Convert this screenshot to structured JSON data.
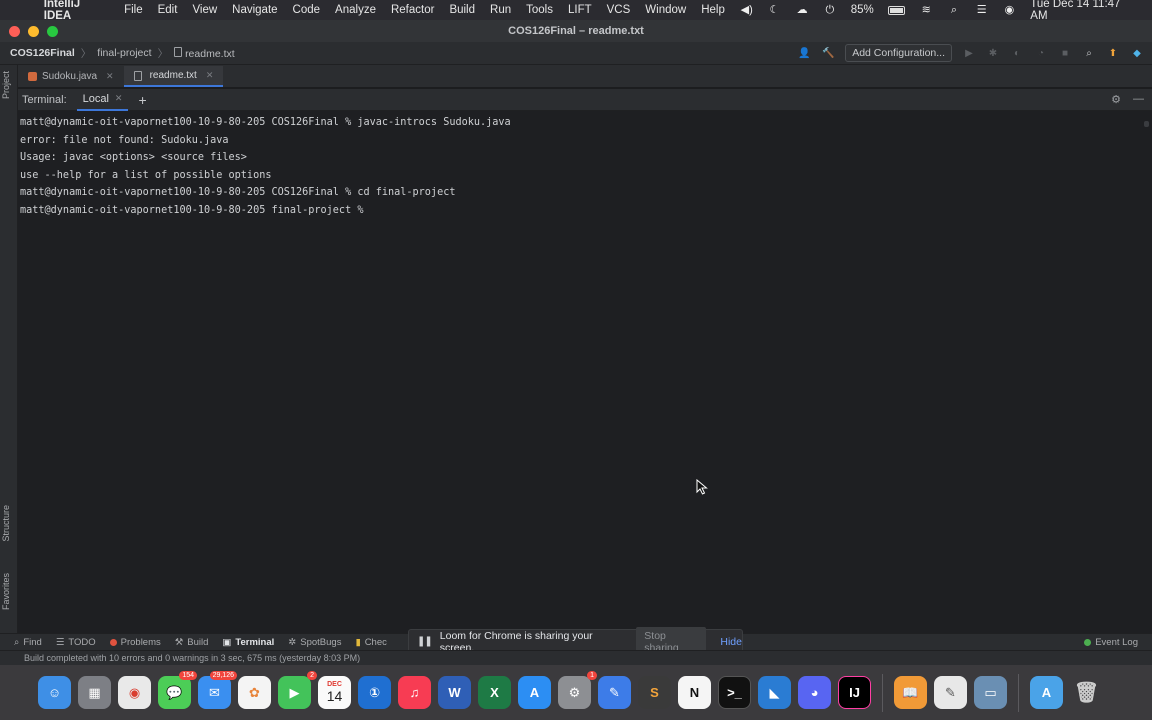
{
  "menubar": {
    "app_name": "IntelliJ IDEA",
    "items": [
      "File",
      "Edit",
      "View",
      "Navigate",
      "Code",
      "Analyze",
      "Refactor",
      "Build",
      "Run",
      "Tools",
      "LIFT",
      "VCS",
      "Window",
      "Help"
    ],
    "battery": "85%",
    "datetime": "Tue Dec 14  11:47 AM"
  },
  "window": {
    "title": "COS126Final – readme.txt"
  },
  "navbar": {
    "project": "COS126Final",
    "folder": "final-project",
    "file": "readme.txt",
    "add_config_label": "Add Configuration..."
  },
  "editor_tabs": [
    {
      "label": "Sudoku.java"
    },
    {
      "label": "readme.txt"
    }
  ],
  "side_labels": {
    "project": "Project",
    "structure": "Structure",
    "favorites": "Favorites"
  },
  "terminal": {
    "title": "Terminal:",
    "tab_label": "Local",
    "lines": [
      "matt@dynamic-oit-vapornet100-10-9-80-205 COS126Final % javac-introcs Sudoku.java",
      "error: file not found: Sudoku.java",
      "Usage: javac <options> <source files>",
      "use --help for a list of possible options",
      "matt@dynamic-oit-vapornet100-10-9-80-205 COS126Final % cd final-project",
      "matt@dynamic-oit-vapornet100-10-9-80-205 final-project % "
    ]
  },
  "bottom_tools": {
    "find": "Find",
    "todo": "TODO",
    "problems": "Problems",
    "build": "Build",
    "terminal": "Terminal",
    "spotbugs": "SpotBugs",
    "checkstyle": "Chec",
    "event_log": "Event Log"
  },
  "loom": {
    "message": "Loom for Chrome is sharing your screen.",
    "stop_label": "Stop sharing",
    "hide_label": "Hide"
  },
  "statusbar": {
    "message": "Build completed with 10 errors and 0 warnings in 3 sec, 675 ms (yesterday 8:03 PM)"
  },
  "dock": {
    "messages_badge": "154",
    "mail_badge": "29,126",
    "facetime_badge": "2",
    "calendar_month": "DEC",
    "calendar_day": "14",
    "settings_badge": "1"
  },
  "colors": {
    "accent": "#3d77d9",
    "terminal_bg": "#1e1f22",
    "panel_bg": "#2b2d30"
  }
}
